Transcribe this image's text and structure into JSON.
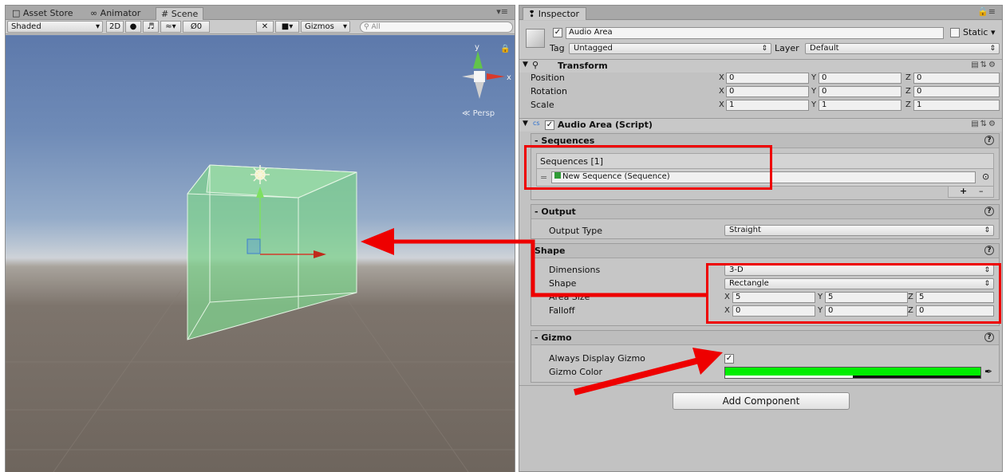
{
  "scene_window": {
    "tabs": [
      {
        "label": "Asset Store",
        "icon": "store-icon"
      },
      {
        "label": "Animator",
        "icon": "animator-icon"
      },
      {
        "label": "Scene",
        "icon": "grid-icon"
      }
    ],
    "toolbar": {
      "shading": "Shaded",
      "mode_2d": "2D",
      "hidden_count": "0",
      "gizmos": "Gizmos",
      "search_placeholder": "All"
    },
    "persp_label": "Persp",
    "gizmo_axes": {
      "y": "y",
      "x": "x"
    }
  },
  "inspector": {
    "tab_label": "Inspector",
    "object": {
      "name": "Audio Area",
      "active": true,
      "static_label": "Static",
      "tag_label": "Tag",
      "tag_value": "Untagged",
      "layer_label": "Layer",
      "layer_value": "Default"
    },
    "transform": {
      "title": "Transform",
      "rows": [
        {
          "label": "Position",
          "x": "0",
          "y": "0",
          "z": "0"
        },
        {
          "label": "Rotation",
          "x": "0",
          "y": "0",
          "z": "0"
        },
        {
          "label": "Scale",
          "x": "1",
          "y": "1",
          "z": "1"
        }
      ]
    },
    "script": {
      "title": "Audio Area (Script)",
      "enabled": true,
      "sequences": {
        "title": "- Sequences",
        "list_header": "Sequences [1]",
        "item": "New Sequence (Sequence)",
        "add": "+",
        "remove": "–"
      },
      "output": {
        "title": "- Output",
        "type_label": "Output Type",
        "type_value": "Straight"
      },
      "shape": {
        "title": "Shape",
        "dimensions_label": "Dimensions",
        "dimensions_value": "3-D",
        "shape_label": "Shape",
        "shape_value": "Rectangle",
        "area_label": "Area Size",
        "area": {
          "x": "5",
          "y": "5",
          "z": "5"
        },
        "falloff_label": "Falloff",
        "falloff": {
          "x": "0",
          "y": "0",
          "z": "0"
        }
      },
      "gizmo": {
        "title": "- Gizmo",
        "always_label": "Always Display Gizmo",
        "always_checked": true,
        "color_label": "Gizmo Color",
        "color": "#00ee00"
      }
    },
    "add_component": "Add Component"
  },
  "colors": {
    "annotation_red": "#ee0000",
    "gizmo_green": "#00ee00"
  }
}
